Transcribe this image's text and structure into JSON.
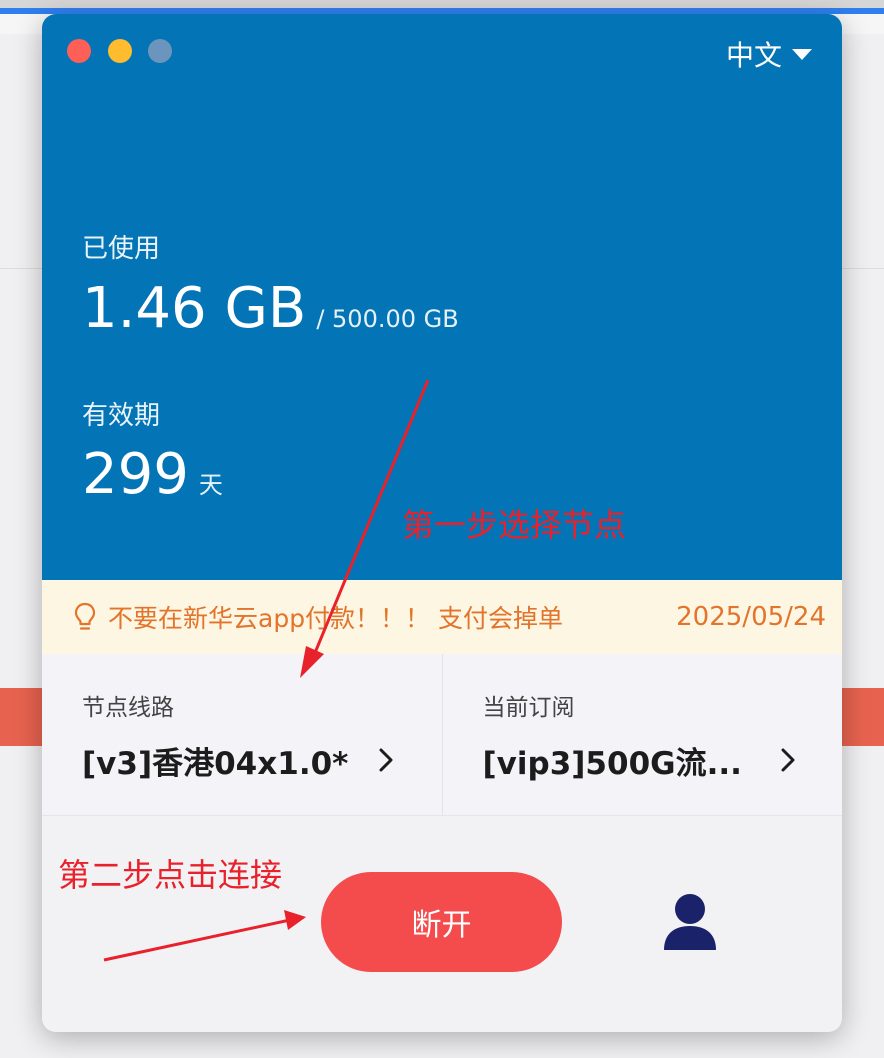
{
  "header": {
    "language_label": "中文"
  },
  "usage": {
    "used_label": "已使用",
    "used_value": "1.46 GB",
    "total_value": "/ 500.00 GB",
    "validity_label": "有效期",
    "validity_value": "299",
    "validity_unit": "天"
  },
  "notice": {
    "message": "不要在新华云app付款！！！ 支付会掉单",
    "date": "2025/05/24"
  },
  "node": {
    "label": "节点线路",
    "value": "[v3]香港04x1.0*"
  },
  "subscription": {
    "label": "当前订阅",
    "value": "[vip3]500G流..."
  },
  "actions": {
    "connect_label": "断开"
  },
  "annotations": {
    "step1": "第一步选择节点",
    "step2": "第二步点击连接"
  },
  "colors": {
    "hero_blue": "#0374b6",
    "connect_red": "#f44b4c",
    "notice_orange": "#e2742b",
    "annotation_red": "#e8212a",
    "user_icon_navy": "#1a2369"
  }
}
